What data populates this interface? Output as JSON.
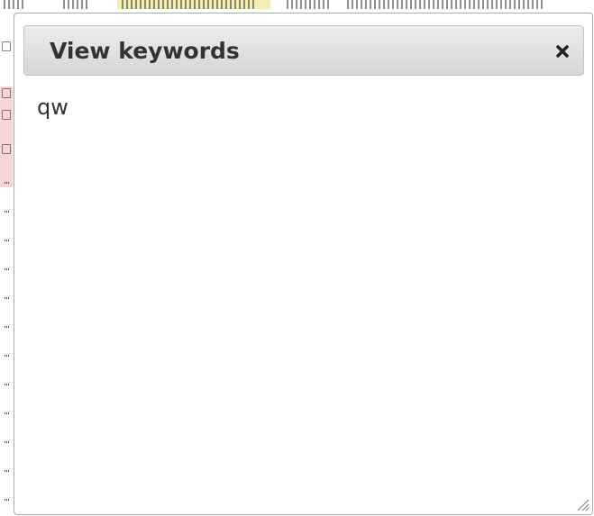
{
  "dialog": {
    "title": "View keywords",
    "close_icon": "close-icon",
    "content_text": "qw",
    "resize_icon": "resize-grip-icon"
  },
  "colors": {
    "title_text": "#333333",
    "titlebar_gradient_top": "#ececec",
    "titlebar_gradient_bottom": "#d6d6d6",
    "border": "#aaaaaa",
    "background_highlight": "#f8d4d4"
  }
}
